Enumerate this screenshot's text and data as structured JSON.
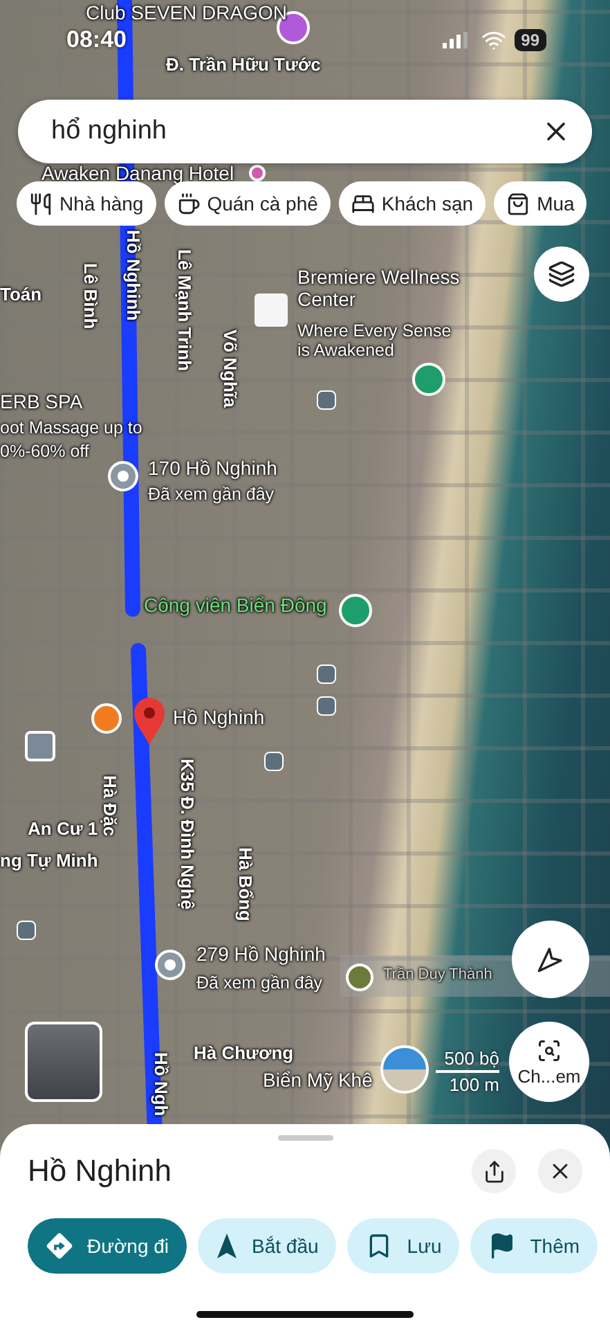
{
  "status_bar": {
    "time": "08:40",
    "battery": "99"
  },
  "search": {
    "value": "hổ nghinh"
  },
  "chips": [
    {
      "kind": "restaurant",
      "label": "Nhà hàng"
    },
    {
      "kind": "cafe",
      "label": "Quán cà phê"
    },
    {
      "kind": "hotel",
      "label": "Khách sạn"
    },
    {
      "kind": "shopping",
      "label": "Mua"
    }
  ],
  "map": {
    "labels": [
      {
        "kind": "place",
        "text": "Club SEVEN DRAGON"
      },
      {
        "kind": "street",
        "text": "Đ. Trần Hữu Tước"
      },
      {
        "kind": "place",
        "text": "Awaken Danang Hotel"
      },
      {
        "kind": "street",
        "text": "Toán"
      },
      {
        "kind": "street",
        "text": "Lê Bình"
      },
      {
        "kind": "street",
        "text": "Hồ Nghinh"
      },
      {
        "kind": "street",
        "text": "Lê Mạnh Trinh"
      },
      {
        "kind": "street",
        "text": "Võ Nghĩa"
      },
      {
        "kind": "place",
        "text": "Bremiere Wellness Center"
      },
      {
        "kind": "note",
        "text": "Where Every Sense is Awakened"
      },
      {
        "kind": "place",
        "text": "ERB SPA"
      },
      {
        "kind": "note",
        "text": "oot Massage up to"
      },
      {
        "kind": "note",
        "text": "0%-60% off"
      },
      {
        "kind": "place",
        "text": "170 Hồ Nghinh"
      },
      {
        "kind": "note",
        "text": "Đã xem gần đây"
      },
      {
        "kind": "park",
        "text": "Công viên Biển Đông"
      },
      {
        "kind": "place",
        "text": "Hồ Nghinh"
      },
      {
        "kind": "street",
        "text": "Hà Đặc"
      },
      {
        "kind": "street",
        "text": "K35 Đ. Đình Nghệ"
      },
      {
        "kind": "street",
        "text": "An Cư 1"
      },
      {
        "kind": "street",
        "text": "ng Tự Minh"
      },
      {
        "kind": "street",
        "text": "Hà Bổng"
      },
      {
        "kind": "place",
        "text": "279 Hồ Nghinh"
      },
      {
        "kind": "note",
        "text": "Đã xem gần đây"
      },
      {
        "kind": "faded",
        "text": "Trần Duy Thành"
      },
      {
        "kind": "street",
        "text": "Hà Chương"
      },
      {
        "kind": "place",
        "text": "Biển Mỹ Khê"
      },
      {
        "kind": "street",
        "text": "Hồ Ngh"
      }
    ],
    "scale": {
      "imperial": "500 bộ",
      "metric": "100 m"
    },
    "lens_button": "Ch...em"
  },
  "sheet": {
    "title": "Hồ Nghinh",
    "actions": [
      {
        "kind": "directions",
        "label": "Đường đi",
        "selected": true
      },
      {
        "kind": "start",
        "label": "Bắt đầu",
        "selected": false
      },
      {
        "kind": "save",
        "label": "Lưu",
        "selected": false
      },
      {
        "kind": "add",
        "label": "Thêm",
        "selected": false
      }
    ]
  }
}
